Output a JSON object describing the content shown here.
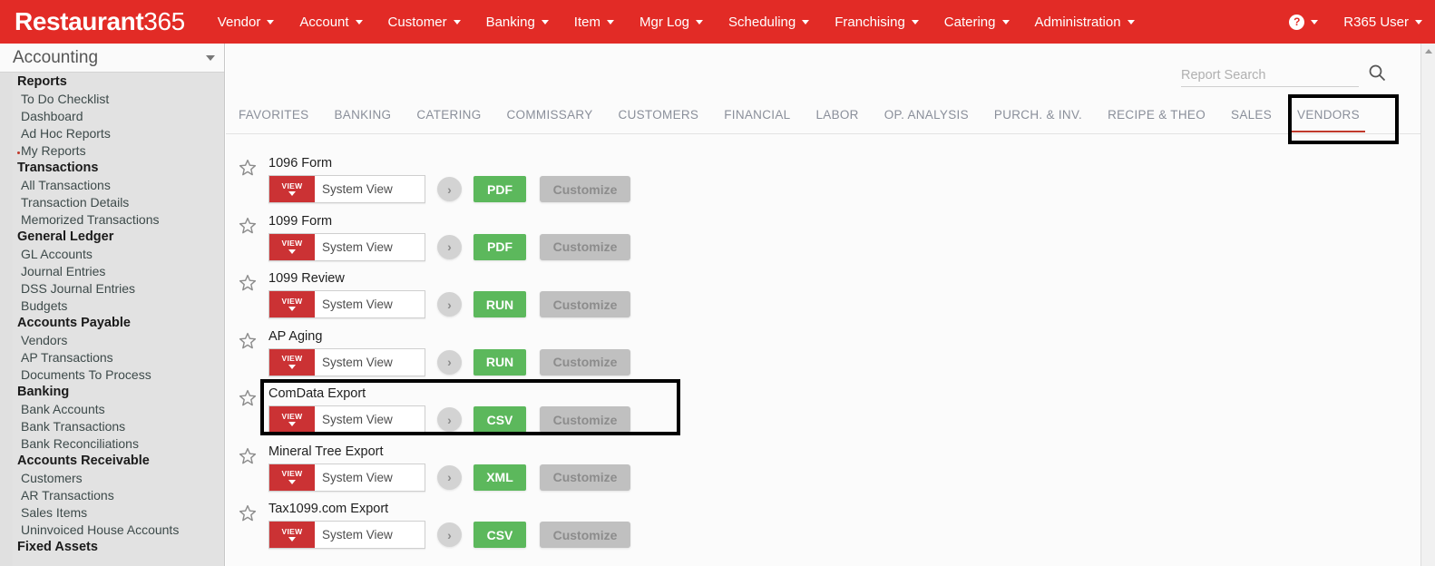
{
  "app": {
    "logo_bold": "Restaurant",
    "logo_light": "365"
  },
  "topnav": {
    "items": [
      {
        "label": "Vendor"
      },
      {
        "label": "Account"
      },
      {
        "label": "Customer"
      },
      {
        "label": "Banking"
      },
      {
        "label": "Item"
      },
      {
        "label": "Mgr Log"
      },
      {
        "label": "Scheduling"
      },
      {
        "label": "Franchising"
      },
      {
        "label": "Catering"
      },
      {
        "label": "Administration"
      }
    ],
    "help_glyph": "?",
    "user_label": "R365 User"
  },
  "sidebar": {
    "selector_label": "Accounting",
    "groups": [
      {
        "label": "Reports",
        "items": [
          {
            "label": "To Do Checklist",
            "marker": false
          },
          {
            "label": "Dashboard",
            "marker": false
          },
          {
            "label": "Ad Hoc Reports",
            "marker": false
          },
          {
            "label": "My Reports",
            "marker": true
          }
        ]
      },
      {
        "label": "Transactions",
        "items": [
          {
            "label": "All Transactions",
            "marker": false
          },
          {
            "label": "Transaction Details",
            "marker": false
          },
          {
            "label": "Memorized Transactions",
            "marker": false
          }
        ]
      },
      {
        "label": "General Ledger",
        "items": [
          {
            "label": "GL Accounts",
            "marker": false
          },
          {
            "label": "Journal Entries",
            "marker": false
          },
          {
            "label": "DSS Journal Entries",
            "marker": false
          },
          {
            "label": "Budgets",
            "marker": false
          }
        ]
      },
      {
        "label": "Accounts Payable",
        "items": [
          {
            "label": "Vendors",
            "marker": false
          },
          {
            "label": "AP Transactions",
            "marker": false
          },
          {
            "label": "Documents To Process",
            "marker": false
          }
        ]
      },
      {
        "label": "Banking",
        "items": [
          {
            "label": "Bank Accounts",
            "marker": false
          },
          {
            "label": "Bank Transactions",
            "marker": false
          },
          {
            "label": "Bank Reconciliations",
            "marker": false
          }
        ]
      },
      {
        "label": "Accounts Receivable",
        "items": [
          {
            "label": "Customers",
            "marker": false
          },
          {
            "label": "AR Transactions",
            "marker": false
          },
          {
            "label": "Sales Items",
            "marker": false
          },
          {
            "label": "Uninvoiced House Accounts",
            "marker": false
          }
        ]
      },
      {
        "label": "Fixed Assets",
        "items": []
      }
    ]
  },
  "search": {
    "placeholder": "Report Search",
    "value": "",
    "icon": "search-icon"
  },
  "tabs": {
    "items": [
      {
        "label": "FAVORITES",
        "active": false
      },
      {
        "label": "BANKING",
        "active": false
      },
      {
        "label": "CATERING",
        "active": false
      },
      {
        "label": "COMMISSARY",
        "active": false
      },
      {
        "label": "CUSTOMERS",
        "active": false
      },
      {
        "label": "FINANCIAL",
        "active": false
      },
      {
        "label": "LABOR",
        "active": false
      },
      {
        "label": "OP. ANALYSIS",
        "active": false
      },
      {
        "label": "PURCH. & INV.",
        "active": false
      },
      {
        "label": "RECIPE & THEO",
        "active": false
      },
      {
        "label": "SALES",
        "active": false
      },
      {
        "label": "VENDORS",
        "active": true
      }
    ]
  },
  "reports": {
    "view_button_label": "VIEW",
    "go_glyph": "›",
    "customize_label": "Customize",
    "rows": [
      {
        "title": "1096 Form",
        "view_value": "System View",
        "action": "PDF",
        "highlighted": false
      },
      {
        "title": "1099 Form",
        "view_value": "System View",
        "action": "PDF",
        "highlighted": false
      },
      {
        "title": "1099 Review",
        "view_value": "System View",
        "action": "RUN",
        "highlighted": false
      },
      {
        "title": "AP Aging",
        "view_value": "System View",
        "action": "RUN",
        "highlighted": false
      },
      {
        "title": "ComData Export",
        "view_value": "System View",
        "action": "CSV",
        "highlighted": true
      },
      {
        "title": "Mineral Tree Export",
        "view_value": "System View",
        "action": "XML",
        "highlighted": false
      },
      {
        "title": "Tax1099.com Export",
        "view_value": "System View",
        "action": "CSV",
        "highlighted": false
      }
    ]
  },
  "colors": {
    "brand_red": "#e22b26",
    "view_red": "#cb3234",
    "action_green": "#5cb85c",
    "customize_gray": "#c0c0c0",
    "active_tab_underline": "#c0392b",
    "annotation": "#000000"
  }
}
